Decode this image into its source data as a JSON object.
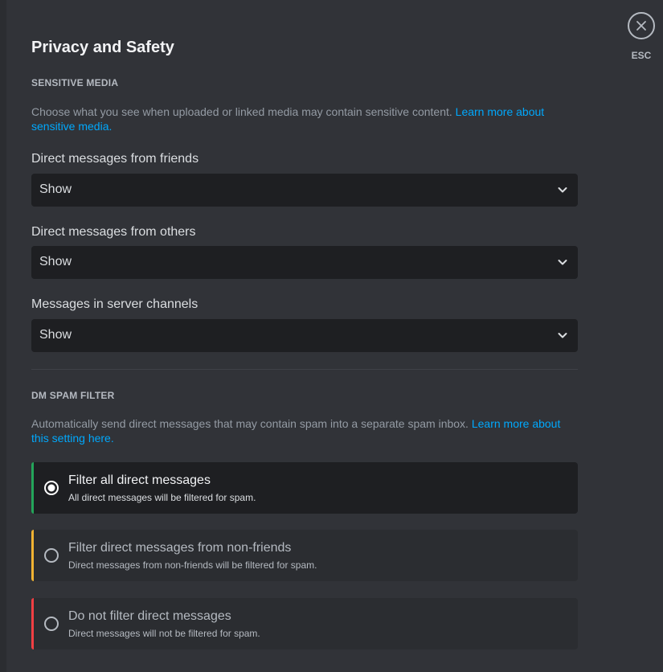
{
  "page": {
    "title": "Privacy and Safety"
  },
  "close": {
    "label": "ESC",
    "icon": "close-icon"
  },
  "sensitive_media": {
    "header": "SENSITIVE MEDIA",
    "description": "Choose what you see when uploaded or linked media may contain sensitive content.",
    "link_text": "Learn more about sensitive media.",
    "fields": [
      {
        "label": "Direct messages from friends",
        "value": "Show"
      },
      {
        "label": "Direct messages from others",
        "value": "Show"
      },
      {
        "label": "Messages in server channels",
        "value": "Show"
      }
    ]
  },
  "dm_spam_filter": {
    "header": "DM SPAM FILTER",
    "description": "Automatically send direct messages that may contain spam into a separate spam inbox.",
    "link_text": "Learn more about this setting here.",
    "options": [
      {
        "title": "Filter all direct messages",
        "subtitle": "All direct messages will be filtered for spam.",
        "selected": true,
        "accent": "#23a55a"
      },
      {
        "title": "Filter direct messages from non-friends",
        "subtitle": "Direct messages from non-friends will be filtered for spam.",
        "selected": false,
        "accent": "#f0b232"
      },
      {
        "title": "Do not filter direct messages",
        "subtitle": "Direct messages will not be filtered for spam.",
        "selected": false,
        "accent": "#f23f43"
      }
    ]
  },
  "colors": {
    "background": "#313338",
    "input_bg": "#1e1f22",
    "link": "#00a8fc"
  }
}
